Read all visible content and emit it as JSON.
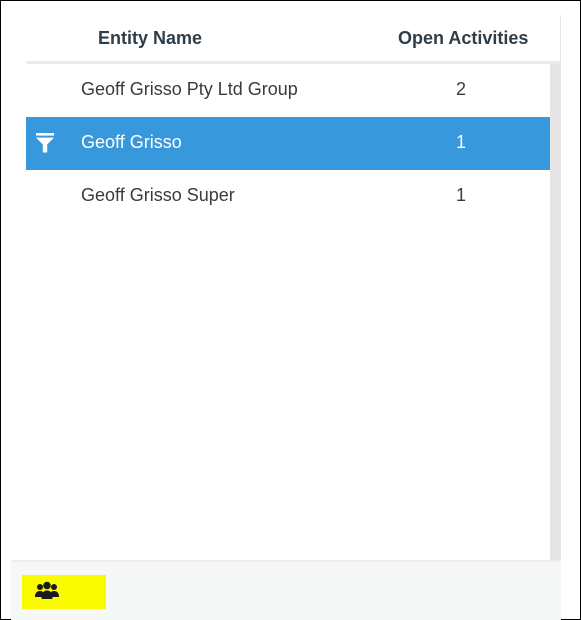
{
  "table": {
    "headers": {
      "entity_name": "Entity Name",
      "open_activities": "Open Activities"
    },
    "rows": [
      {
        "name": "Geoff Grisso Pty Ltd Group",
        "open_activities": "2",
        "selected": false
      },
      {
        "name": "Geoff Grisso",
        "open_activities": "1",
        "selected": true
      },
      {
        "name": "Geoff Grisso Super",
        "open_activities": "1",
        "selected": false
      }
    ]
  },
  "icons": {
    "filter": "filter-icon",
    "group": "users-group-icon"
  },
  "colors": {
    "selected_row": "#3898dc",
    "header_text": "#2f3d48",
    "footer_button": "#fbfb00"
  }
}
